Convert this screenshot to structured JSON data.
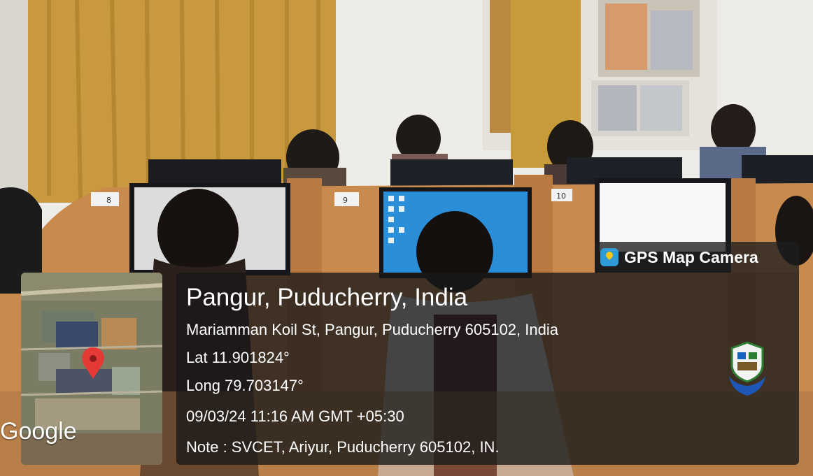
{
  "badge": {
    "label": "GPS Map Camera",
    "icon": "gps-map-camera-icon"
  },
  "location": {
    "title": "Pangur, Puducherry, India",
    "address": "Mariamman Koil St, Pangur, Puducherry 605102, India",
    "lat": "Lat 11.901824°",
    "long": "Long 79.703147°",
    "datetime": "09/03/24 11:16 AM GMT +05:30",
    "note": "Note : SVCET, Ariyur, Puducherry 605102, IN."
  },
  "map": {
    "provider": "Google",
    "pin_color": "#e53935"
  },
  "desks": {
    "numbers": [
      "8",
      "9",
      "10"
    ]
  },
  "colors": {
    "overlay": "#181818",
    "curtain": "#c79a3a",
    "desk": "#c9884a"
  }
}
